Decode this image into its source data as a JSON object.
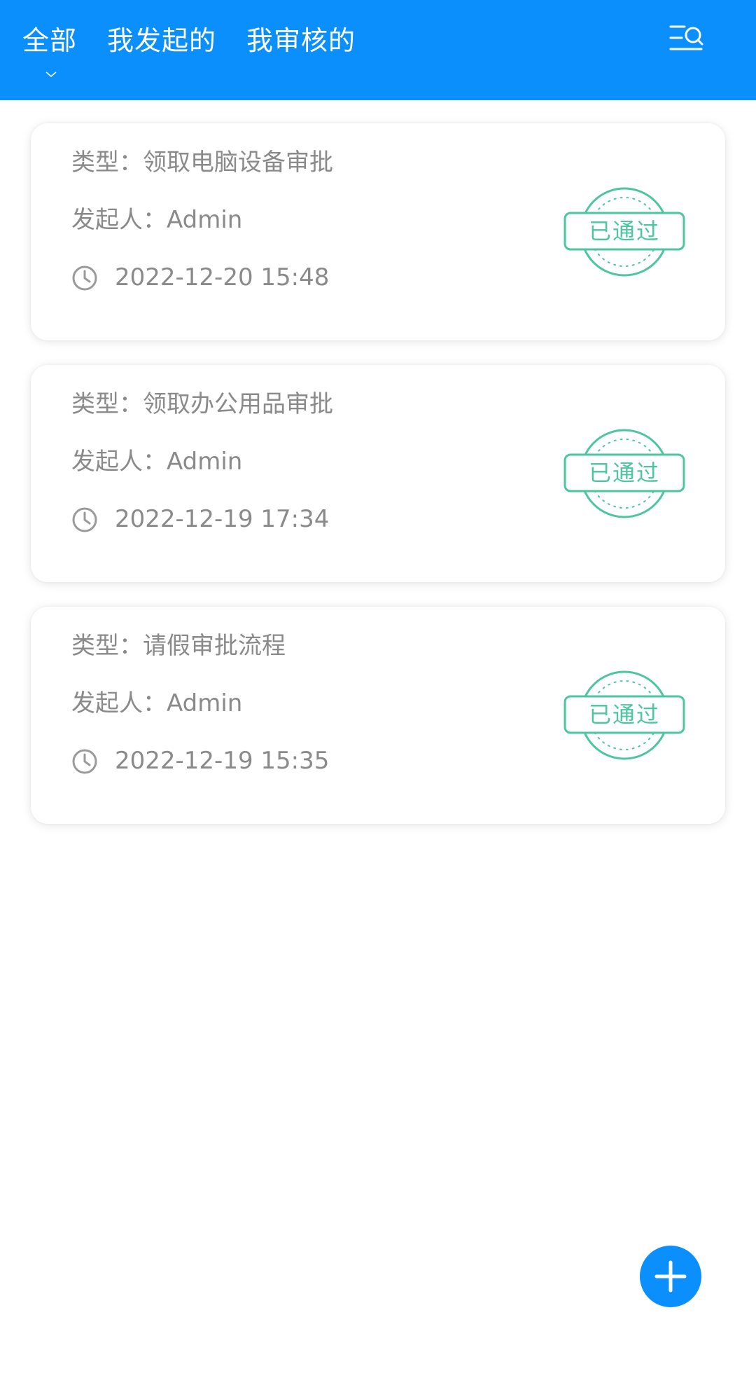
{
  "header": {
    "tabs": [
      {
        "label": "全部",
        "active": true
      },
      {
        "label": "我发起的",
        "active": false
      },
      {
        "label": "我审核的",
        "active": false
      }
    ],
    "filter_icon": "list-search-icon",
    "background": "#0a8ffd"
  },
  "records": [
    {
      "type": "类型：领取电脑设备审批",
      "initiator": "发起人：Admin",
      "time": "2022-12-20 15:48",
      "stamp": "已通过"
    },
    {
      "type": "类型：领取办公用品审批",
      "initiator": "发起人：Admin",
      "time": "2022-12-19 17:34",
      "stamp": "已通过"
    },
    {
      "type": "类型：请假审批流程",
      "initiator": "发起人：Admin",
      "time": "2022-12-19 15:35",
      "stamp": "已通过"
    }
  ],
  "fab": {
    "icon": "plus-icon"
  },
  "colors": {
    "accent": "#0a8ffd",
    "stamp_green": "#4cc79d",
    "text_gray": "#8a8a8a"
  }
}
